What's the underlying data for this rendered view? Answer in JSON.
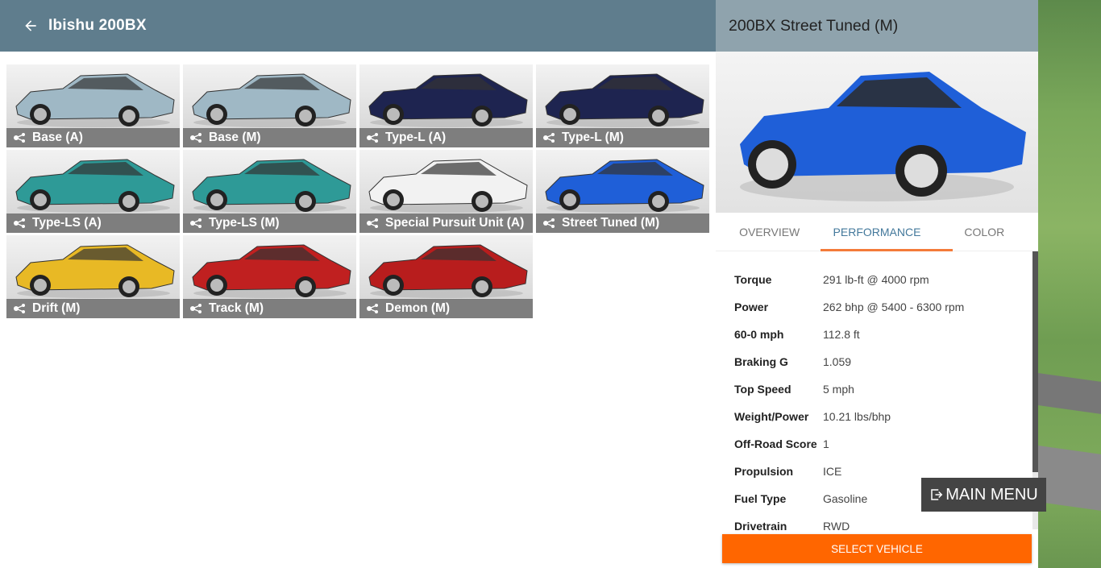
{
  "header": {
    "title": "Ibishu 200BX"
  },
  "tiles": [
    {
      "label": "Base (A)",
      "color": "#9fb8c5"
    },
    {
      "label": "Base (M)",
      "color": "#9fb8c5"
    },
    {
      "label": "Type-L (A)",
      "color": "#1e2450"
    },
    {
      "label": "Type-L (M)",
      "color": "#1e2450"
    },
    {
      "label": "Type-LS (A)",
      "color": "#2e9a97"
    },
    {
      "label": "Type-LS (M)",
      "color": "#2e9a97"
    },
    {
      "label": "Special Pursuit Unit (A)",
      "color": "#f2f2f2"
    },
    {
      "label": "Street Tuned (M)",
      "color": "#1f5fd8"
    },
    {
      "label": "Drift (M)",
      "color": "#e8b925"
    },
    {
      "label": "Track (M)",
      "color": "#c02020"
    },
    {
      "label": "Demon (M)",
      "color": "#b81d1d"
    }
  ],
  "detail": {
    "title": "200BX Street Tuned (M)",
    "preview_color": "#1f5fd8",
    "tabs": [
      "OVERVIEW",
      "PERFORMANCE",
      "COLOR"
    ],
    "active_tab": "PERFORMANCE",
    "specs": [
      {
        "key": "Torque",
        "value": "291 lb-ft @ 4000 rpm"
      },
      {
        "key": "Power",
        "value": "262 bhp @ 5400 - 6300 rpm"
      },
      {
        "key": "60-0 mph",
        "value": "112.8 ft"
      },
      {
        "key": "Braking G",
        "value": "1.059"
      },
      {
        "key": "Top Speed",
        "value": "5 mph"
      },
      {
        "key": "Weight/Power",
        "value": "10.21 lbs/bhp"
      },
      {
        "key": "Off-Road Score",
        "value": "1"
      },
      {
        "key": "Propulsion",
        "value": "ICE"
      },
      {
        "key": "Fuel Type",
        "value": "Gasoline"
      },
      {
        "key": "Drivetrain",
        "value": "RWD"
      }
    ],
    "select_label": "SELECT VEHICLE"
  },
  "main_menu": {
    "label": "MAIN MENU"
  },
  "colors": {
    "accent": "#ff6600",
    "topbar": "#5f7d8d",
    "tab_active": "#43789b"
  }
}
